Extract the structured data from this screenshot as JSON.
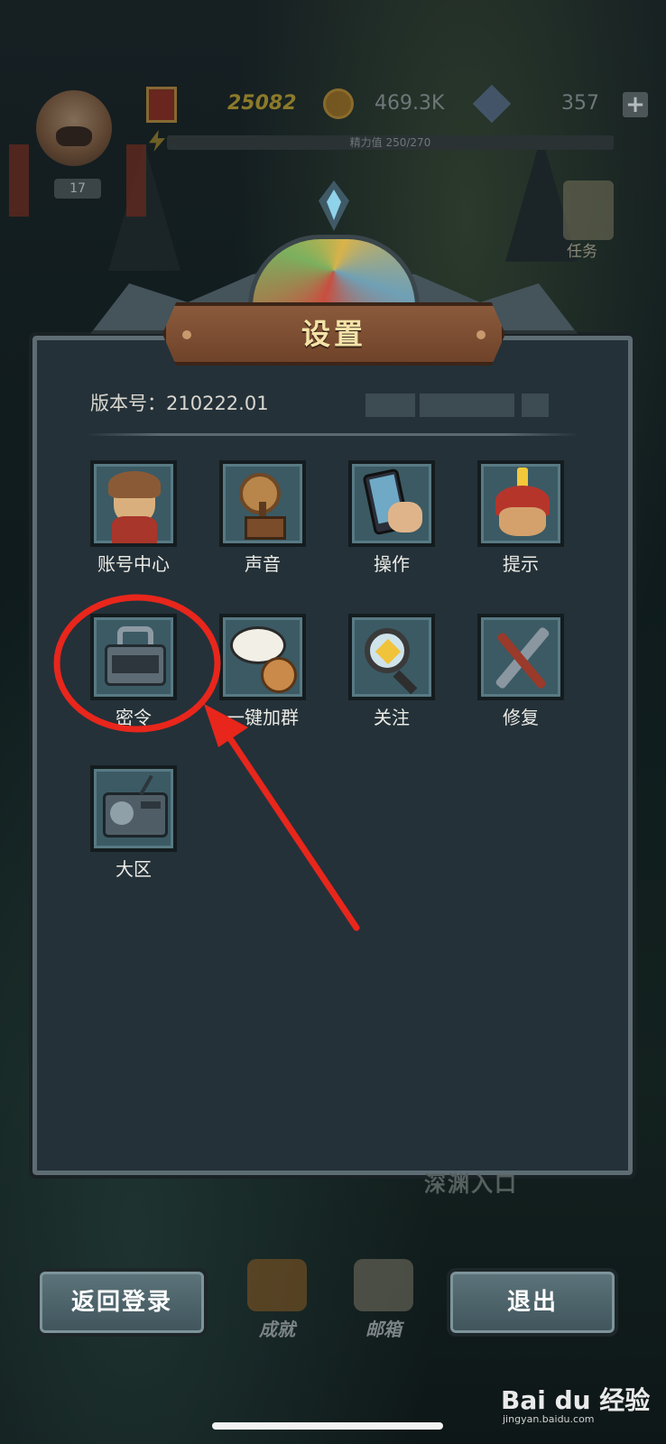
{
  "hud": {
    "level": "17",
    "power": "25082",
    "coins": "469.3K",
    "gems": "357",
    "energy_label": "精力值 250/270",
    "task_label": "任务"
  },
  "panel": {
    "title": "设置",
    "version": "版本号：210222.01"
  },
  "settings_items": [
    {
      "label": "账号中心",
      "icon": "account-icon"
    },
    {
      "label": "声音",
      "icon": "gramophone-icon"
    },
    {
      "label": "操作",
      "icon": "phone-touch-icon"
    },
    {
      "label": "提示",
      "icon": "hint-helmet-icon"
    },
    {
      "label": "密令",
      "icon": "combination-lock-icon"
    },
    {
      "label": "一键加群",
      "icon": "speech-bubble-icon"
    },
    {
      "label": "关注",
      "icon": "magnifier-icon"
    },
    {
      "label": "修复",
      "icon": "wrench-screwdriver-icon"
    },
    {
      "label": "大区",
      "icon": "radio-icon"
    }
  ],
  "background": {
    "abyss_label": "深渊入口"
  },
  "dock": {
    "achievement_label": "成就",
    "mail_label": "邮箱"
  },
  "buttons": {
    "back_login": "返回登录",
    "exit": "退出"
  },
  "watermark": {
    "brand": "Bai du 经验",
    "url": "jingyan.baidu.com"
  },
  "colors": {
    "annotation_red": "#e8261c",
    "title_text": "#f3e3a8",
    "panel_bg": "#243139"
  }
}
